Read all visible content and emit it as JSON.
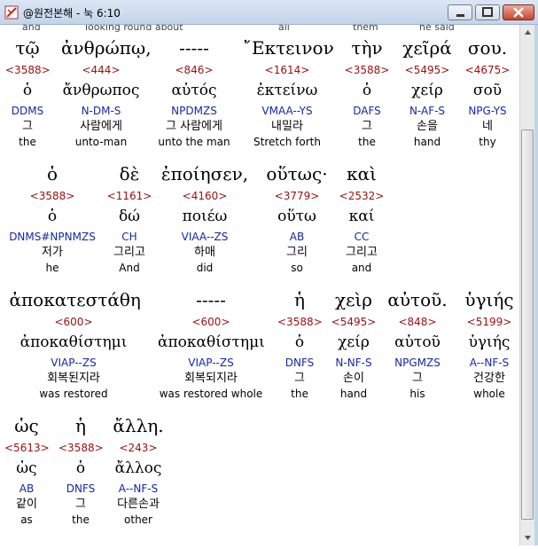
{
  "window": {
    "title": "@원전본해 - 눅 6:10",
    "icon": "scroll-quill-icon"
  },
  "controls": {
    "minimize": "minimize-icon",
    "maximize": "maximize-icon",
    "close": "close-icon"
  },
  "top_partial": [
    "and",
    "looking round about",
    "all",
    "them",
    "he said"
  ],
  "words": [
    {
      "greek": "τῷ",
      "strongs": "<3588>",
      "lemma": "ὁ",
      "parse": "DDMS",
      "korean": "그",
      "english": "the"
    },
    {
      "greek": "ἀνθρώπῳ,",
      "strongs": "<444>",
      "lemma": "ἄνθρωπος",
      "parse": "N-DM-S",
      "korean": "사람에게",
      "english": "unto-man"
    },
    {
      "greek": "-----",
      "strongs": "<846>",
      "lemma": "αὐτός",
      "parse": "NPDMZS",
      "korean": "그 사람에게",
      "english": "unto the man"
    },
    {
      "greek": "῎Εκτεινον",
      "strongs": "<1614>",
      "lemma": "ἐκτείνω",
      "parse": "VMAA--YS",
      "korean": "내밀라",
      "english": "Stretch forth"
    },
    {
      "greek": "τὴν",
      "strongs": "<3588>",
      "lemma": "ὁ",
      "parse": "DAFS",
      "korean": "그",
      "english": "the"
    },
    {
      "greek": "χεῖρά",
      "strongs": "<5495>",
      "lemma": "χείρ",
      "parse": "N-AF-S",
      "korean": "손을",
      "english": "hand"
    },
    {
      "greek": "σου.",
      "strongs": "<4675>",
      "lemma": "σοῦ",
      "parse": "NPG-YS",
      "korean": "네",
      "english": "thy"
    },
    {
      "greek": "ὁ",
      "strongs": "<3588>",
      "lemma": "ὁ",
      "parse": "DNMS#NPNMZS",
      "korean": "저가",
      "english": "he"
    },
    {
      "greek": "δὲ",
      "strongs": "<1161>",
      "lemma": "δώ",
      "parse": "CH",
      "korean": "그리고",
      "english": "And"
    },
    {
      "greek": "ἐποίησεν,",
      "strongs": "<4160>",
      "lemma": "ποιέω",
      "parse": "VIAA--ZS",
      "korean": "하매",
      "english": "did"
    },
    {
      "greek": "οὕτως·",
      "strongs": "<3779>",
      "lemma": "οὕτω",
      "parse": "AB",
      "korean": "그리",
      "english": "so"
    },
    {
      "greek": "καὶ",
      "strongs": "<2532>",
      "lemma": "καί",
      "parse": "CC",
      "korean": "그리고",
      "english": "and"
    },
    {
      "greek": "ἀποκατεστάθη",
      "strongs": "<600>",
      "lemma": "ἀποκαθίστημι",
      "parse": "VIAP--ZS",
      "korean": "회복된지라",
      "english": "was restored"
    },
    {
      "greek": "-----",
      "strongs": "<600>",
      "lemma": "ἀποκαθίστημι",
      "parse": "VIAP--ZS",
      "korean": "회복되지라",
      "english": "was restored whole"
    },
    {
      "greek": "ἡ",
      "strongs": "<3588>",
      "lemma": "ὁ",
      "parse": "DNFS",
      "korean": "그",
      "english": "the"
    },
    {
      "greek": "χεὶρ",
      "strongs": "<5495>",
      "lemma": "χείρ",
      "parse": "N-NF-S",
      "korean": "손이",
      "english": "hand"
    },
    {
      "greek": "αὐτοῦ.",
      "strongs": "<848>",
      "lemma": "αὑτοῦ",
      "parse": "NPGMZS",
      "korean": "그",
      "english": "his"
    },
    {
      "greek": "ὑγιής",
      "strongs": "<5199>",
      "lemma": "ὑγιής",
      "parse": "A--NF-S",
      "korean": "건강한",
      "english": "whole"
    },
    {
      "greek": "ὡς",
      "strongs": "<5613>",
      "lemma": "ὡς",
      "parse": "AB",
      "korean": "같이",
      "english": "as"
    },
    {
      "greek": "ἡ",
      "strongs": "<3588>",
      "lemma": "ὁ",
      "parse": "DNFS",
      "korean": "그",
      "english": "the"
    },
    {
      "greek": "ἄλλη.",
      "strongs": "<243>",
      "lemma": "ἄλλος",
      "parse": "A--NF-S",
      "korean": "다른손과",
      "english": "other"
    }
  ],
  "colors": {
    "strongs": "#9a1010",
    "parse": "#1428a8",
    "text": "#000000"
  }
}
